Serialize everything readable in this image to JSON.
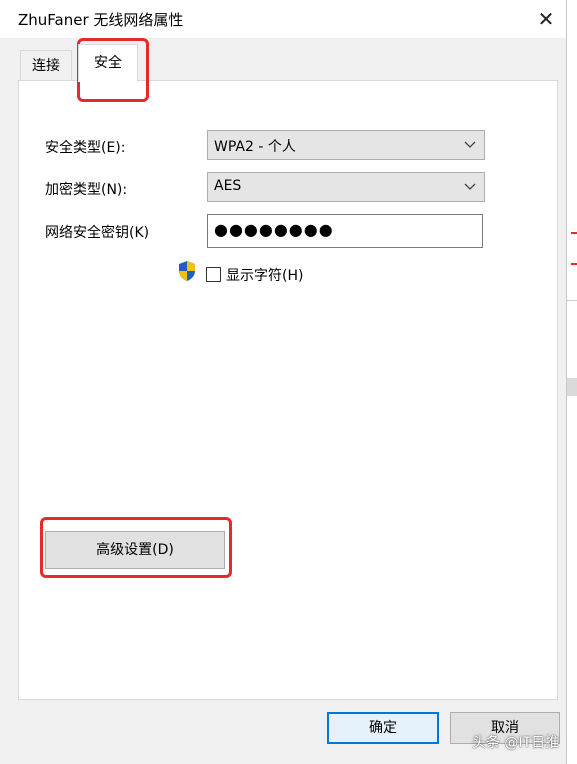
{
  "window": {
    "title": "ZhuFaner 无线网络属性",
    "close_glyph": "✕"
  },
  "tabs": [
    {
      "label": "连接",
      "selected": false
    },
    {
      "label": "安全",
      "selected": true
    }
  ],
  "security": {
    "type_label": "安全类型(E):",
    "type_value": "WPA2 - 个人",
    "encryption_label": "加密类型(N):",
    "encryption_value": "AES",
    "key_label": "网络安全密钥(K)",
    "key_value": "●●●●●●●●",
    "show_chars_label": "显示字符(H)",
    "show_chars_checked": false,
    "advanced_button": "高级设置(D)"
  },
  "footer": {
    "ok": "确定",
    "cancel": "取消"
  },
  "watermark": "头条 @IT日推",
  "colors": {
    "highlight": "#e52a2a",
    "accent": "#0078d7"
  },
  "icons": {
    "dropdown": "chevron-down-icon",
    "uac": "shield-icon",
    "close": "close-icon"
  }
}
